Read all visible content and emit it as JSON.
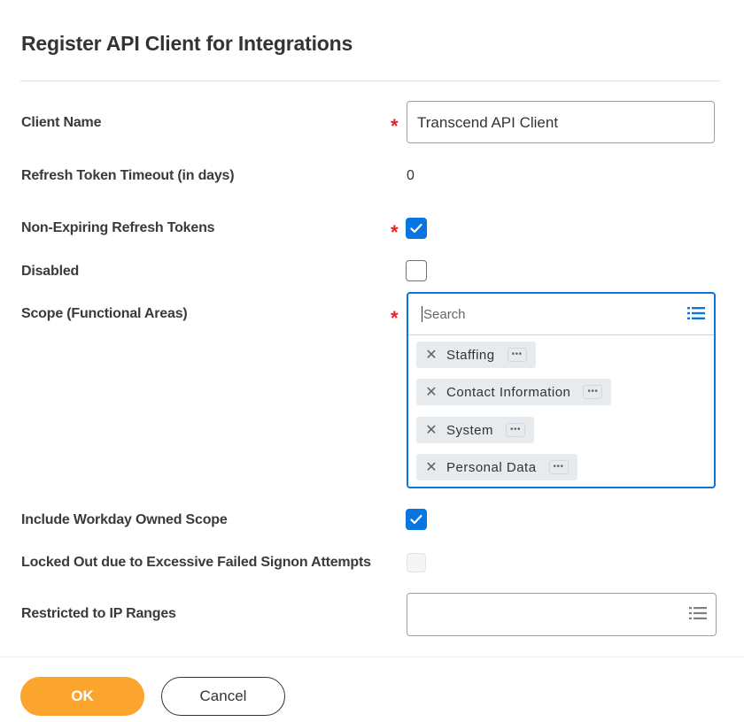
{
  "dialog": {
    "title": "Register API Client for Integrations"
  },
  "fields": {
    "client_name": {
      "label": "Client Name",
      "required": true,
      "value": "Transcend API Client"
    },
    "refresh_token_timeout": {
      "label": "Refresh Token Timeout (in days)",
      "value": "0"
    },
    "non_expiring_refresh_tokens": {
      "label": "Non-Expiring Refresh Tokens",
      "required": true,
      "checked": true
    },
    "disabled": {
      "label": "Disabled",
      "checked": false
    },
    "scope": {
      "label": "Scope (Functional Areas)",
      "required": true,
      "search_placeholder": "Search",
      "selected": [
        {
          "label": "Staffing"
        },
        {
          "label": "Contact Information"
        },
        {
          "label": "System"
        },
        {
          "label": "Personal Data"
        }
      ],
      "more_glyph": "•••",
      "remove_glyph": "✕"
    },
    "include_workday_owned_scope": {
      "label": "Include Workday Owned Scope",
      "checked": true
    },
    "locked_out": {
      "label": "Locked Out due to Excessive Failed Signon Attempts",
      "checked": false,
      "disabled": true
    },
    "restricted_ip_ranges": {
      "label": "Restricted to IP Ranges",
      "value": ""
    }
  },
  "required_marker": "*",
  "actions": {
    "ok_label": "OK",
    "cancel_label": "Cancel"
  },
  "colors": {
    "accent_blue": "#0875e1",
    "ok_orange": "#fba52f",
    "required_red": "#e8202a"
  }
}
